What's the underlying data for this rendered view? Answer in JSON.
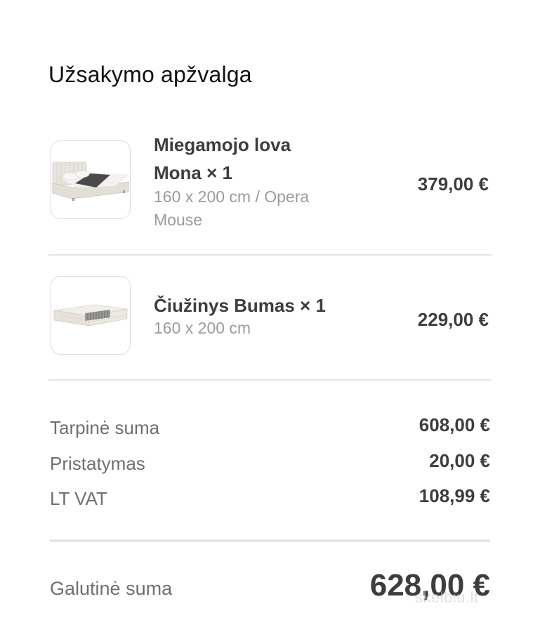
{
  "header": {
    "title": "Užsakymo apžvalga"
  },
  "items": [
    {
      "name_line1": "Miegamojo lova",
      "name_line2": "Mona × 1",
      "variant_line1": "160 x 200 cm / Opera",
      "variant_line2": "Mouse",
      "price": "379,00 €",
      "image": "bed-image"
    },
    {
      "name_line1": "Čiužinys Bumas × 1",
      "variant_line1": "160 x 200 cm",
      "price": "229,00 €",
      "image": "mattress-image"
    }
  ],
  "summary": {
    "subtotal_label": "Tarpinė suma",
    "subtotal_value": "608,00 €",
    "shipping_label": "Pristatymas",
    "shipping_value": "20,00 €",
    "vat_label": "LT VAT",
    "vat_value": "108,99 €",
    "total_label": "Galutinė suma",
    "total_value": "628,00 €"
  },
  "watermark": "skelbiu.lt",
  "colors": {
    "text_primary": "#3d3d3f",
    "text_secondary": "#9b9b9f",
    "divider": "#e4e4e6",
    "background": "#ffffff"
  }
}
